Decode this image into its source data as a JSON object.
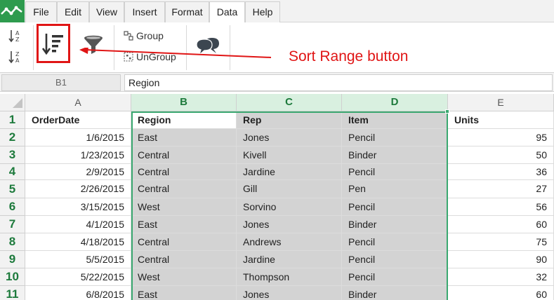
{
  "menu": {
    "tabs": [
      {
        "label": "File"
      },
      {
        "label": "Edit"
      },
      {
        "label": "View"
      },
      {
        "label": "Insert"
      },
      {
        "label": "Format"
      },
      {
        "label": "Data",
        "active": true
      },
      {
        "label": "Help"
      }
    ]
  },
  "ribbon": {
    "group_label": "Group",
    "ungroup_label": "UnGroup"
  },
  "annotation": {
    "text": "Sort Range button",
    "color": "#e01515"
  },
  "formula_bar": {
    "cell_ref": "B1",
    "value": "Region"
  },
  "sheet": {
    "columns": [
      "A",
      "B",
      "C",
      "D",
      "E"
    ],
    "selected_columns": [
      "B",
      "C",
      "D"
    ],
    "row_numbers": [
      "1",
      "2",
      "3",
      "4",
      "5",
      "6",
      "7",
      "8",
      "9",
      "10",
      "11"
    ],
    "header_row": [
      "OrderDate",
      "Region",
      "Rep",
      "Item",
      "Units"
    ],
    "rows": [
      [
        "1/6/2015",
        "East",
        "Jones",
        "Pencil",
        "95"
      ],
      [
        "1/23/2015",
        "Central",
        "Kivell",
        "Binder",
        "50"
      ],
      [
        "2/9/2015",
        "Central",
        "Jardine",
        "Pencil",
        "36"
      ],
      [
        "2/26/2015",
        "Central",
        "Gill",
        "Pen",
        "27"
      ],
      [
        "3/15/2015",
        "West",
        "Sorvino",
        "Pencil",
        "56"
      ],
      [
        "4/1/2015",
        "East",
        "Jones",
        "Binder",
        "60"
      ],
      [
        "4/18/2015",
        "Central",
        "Andrews",
        "Pencil",
        "75"
      ],
      [
        "5/5/2015",
        "Central",
        "Jardine",
        "Pencil",
        "90"
      ],
      [
        "5/22/2015",
        "West",
        "Thompson",
        "Pencil",
        "32"
      ],
      [
        "6/8/2015",
        "East",
        "Jones",
        "Binder",
        "60"
      ]
    ]
  },
  "colors": {
    "brand": "#2e9b4e",
    "selection": "#3aa870",
    "selected_header_bg": "#d9f0e0",
    "selected_fill": "#d3d3d3"
  }
}
